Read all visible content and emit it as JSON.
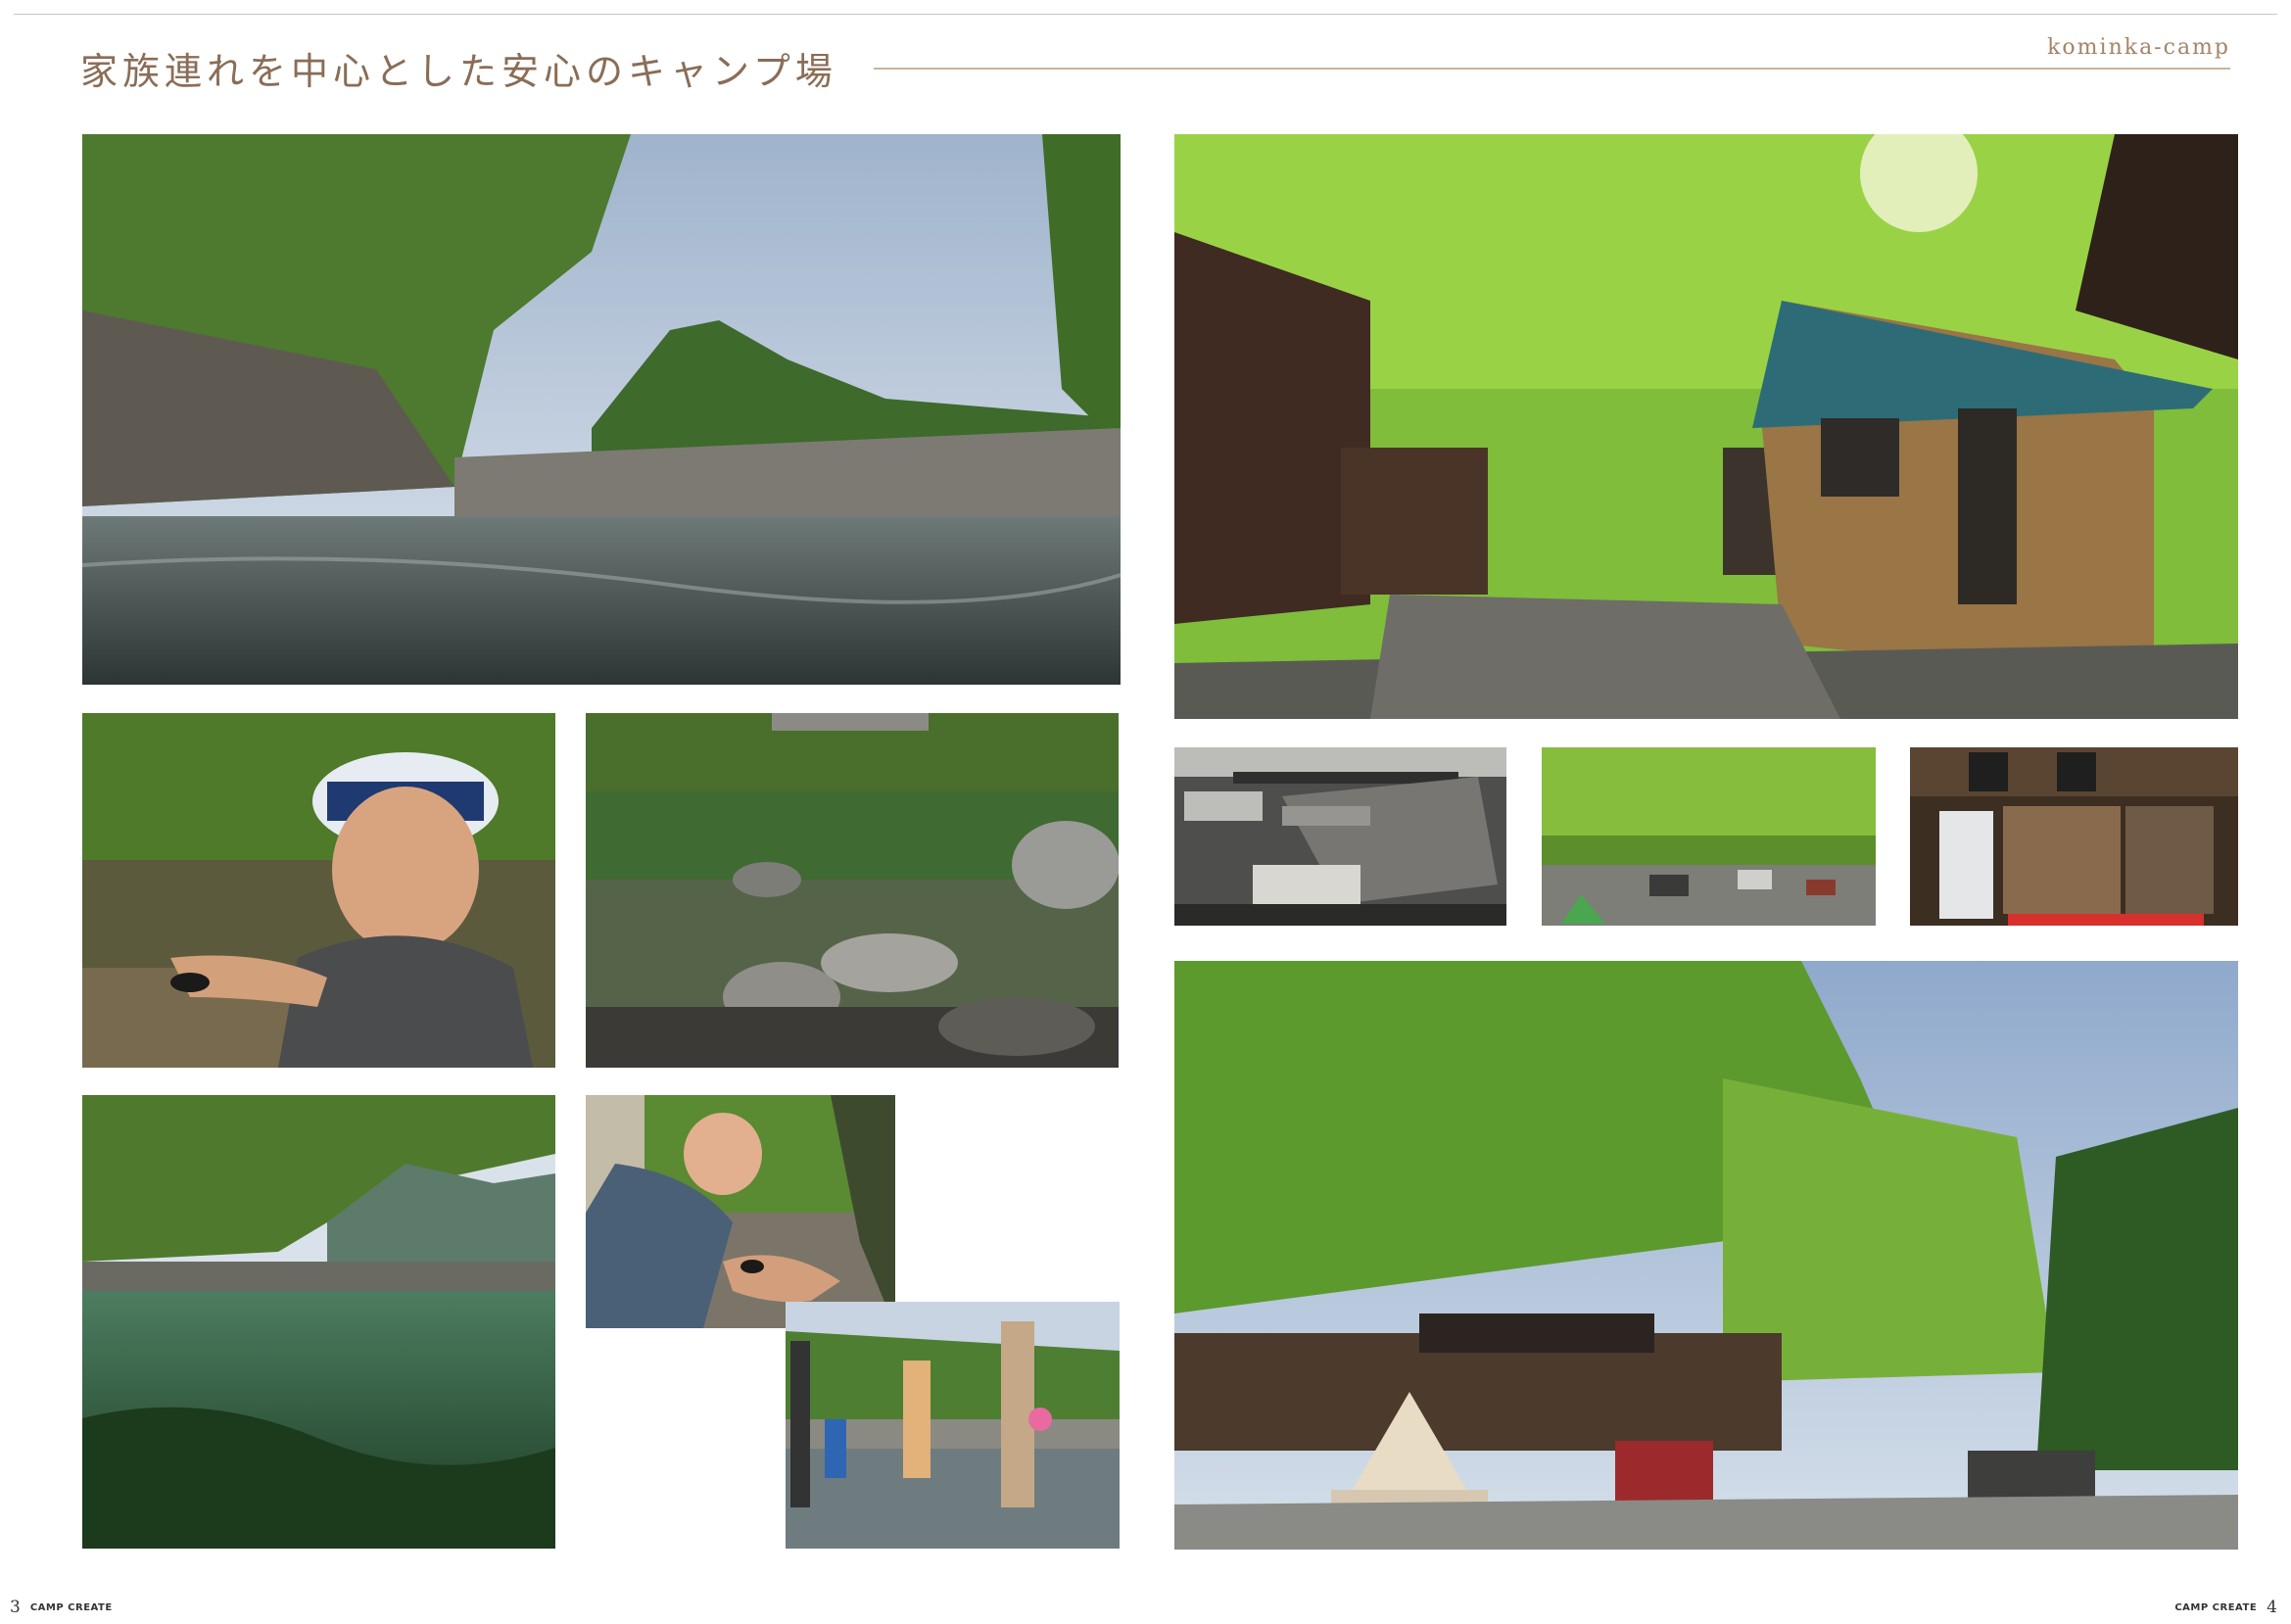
{
  "header": {
    "title": "家族連れを中心とした安心のキャンプ場",
    "tag": "kominka-camp"
  },
  "footer": {
    "left_page_number": "3",
    "right_page_number": "4",
    "brand": "CAMP CREATE"
  },
  "photos": [
    {
      "name": "river-landscape-photo",
      "subject": "river with stone wall and mountain"
    },
    {
      "name": "cabins-under-trees-photo",
      "subject": "wooden cabins in green forest"
    },
    {
      "name": "boy-holding-creature-photo",
      "subject": "smiling boy in cap by the water"
    },
    {
      "name": "river-rocks-photo",
      "subject": "calm river with rocks"
    },
    {
      "name": "bbq-area-photo",
      "subject": "covered barbecue area with benches"
    },
    {
      "name": "campsite-cars-photo",
      "subject": "cars and tents under green trees"
    },
    {
      "name": "camp-shop-photo",
      "subject": "shop shelves and freezer"
    },
    {
      "name": "underwater-river-photo",
      "subject": "half underwater view of river"
    },
    {
      "name": "baby-hands-photo",
      "subject": "baby touching creature in adult hands"
    },
    {
      "name": "family-in-river-photo",
      "subject": "family playing in shallow river"
    },
    {
      "name": "bell-tent-camp-photo",
      "subject": "bell tent, red van and tall trees"
    }
  ],
  "colors": {
    "title": "#8a6d57",
    "rule": "#c9b39f"
  }
}
